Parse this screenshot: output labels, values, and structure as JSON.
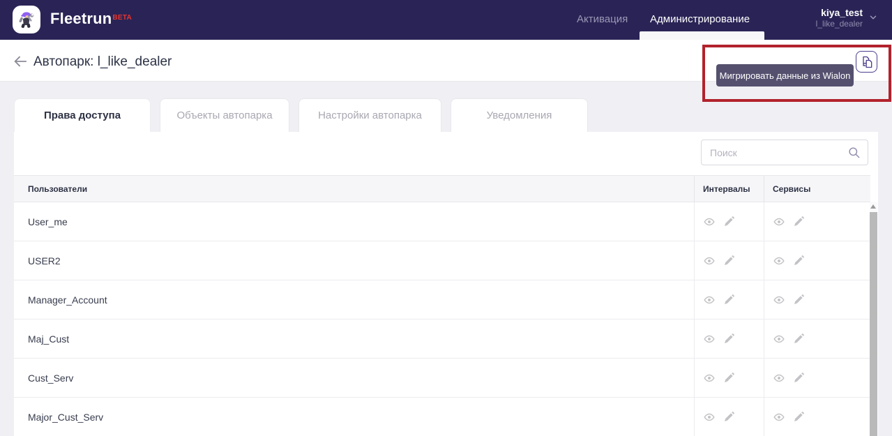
{
  "navbar": {
    "brand": "Fleetrun",
    "beta": "BETA",
    "items": [
      {
        "label": "Активация",
        "active": false
      },
      {
        "label": "Администрирование",
        "active": true
      }
    ],
    "user": {
      "name": "kiya_test",
      "account": "l_like_dealer"
    }
  },
  "header": {
    "title": "Автопарк: l_like_dealer",
    "migrate_tooltip": "Мигрировать данные из Wialon"
  },
  "tabs": [
    {
      "label": "Права доступа",
      "active": true
    },
    {
      "label": "Объекты автопарка",
      "active": false
    },
    {
      "label": "Настройки автопарка",
      "active": false
    },
    {
      "label": "Уведомления",
      "active": false
    }
  ],
  "search": {
    "placeholder": "Поиск"
  },
  "table": {
    "columns": [
      "Пользователи",
      "Интервалы",
      "Сервисы"
    ],
    "rows": [
      {
        "name": "User_me"
      },
      {
        "name": "USER2"
      },
      {
        "name": "Manager_Account"
      },
      {
        "name": "Maj_Cust"
      },
      {
        "name": "Cust_Serv"
      },
      {
        "name": "Major_Cust_Serv"
      }
    ]
  },
  "colors": {
    "navbar_bg": "#2a2456",
    "accent_purple": "#4a3e8e",
    "beta_red": "#e8352e",
    "annotation_red": "#b2222c",
    "tooltip_bg": "#56506f"
  }
}
